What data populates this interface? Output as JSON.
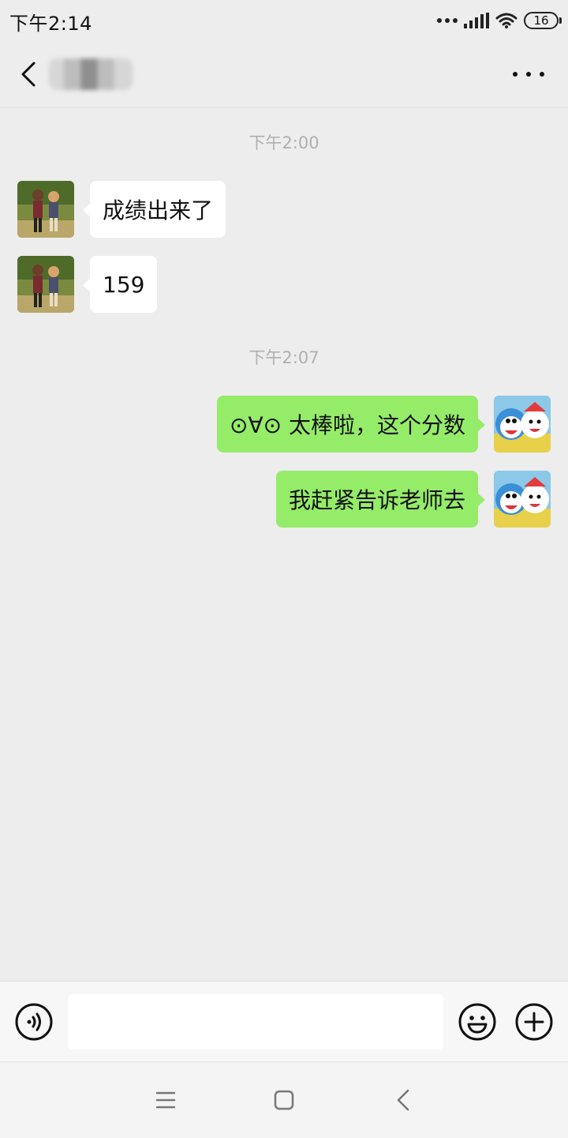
{
  "status_bar": {
    "time": "下午2:14",
    "battery": "16"
  },
  "header": {
    "contact_name": "",
    "back_icon": "chevron-left-icon",
    "more_icon": "more-dots-icon"
  },
  "chat": {
    "timestamps": [
      "下午2:00",
      "下午2:07"
    ],
    "messages": [
      {
        "side": "left",
        "text": "成绩出来了"
      },
      {
        "side": "left",
        "text": "159"
      },
      {
        "side": "right",
        "text": "⊙∀⊙ 太棒啦，这个分数"
      },
      {
        "side": "right",
        "text": "我赶紧告诉老师去"
      }
    ]
  },
  "input_bar": {
    "placeholder": "",
    "voice_icon": "voice-icon",
    "emoji_icon": "emoji-icon",
    "plus_icon": "plus-icon"
  },
  "system_nav": {
    "icons": [
      "menu-icon",
      "home-icon",
      "back-icon"
    ]
  },
  "colors": {
    "background": "#ededed",
    "sent_bubble": "#95ec69",
    "received_bubble": "#ffffff",
    "timestamp_text": "#b0b0b0"
  }
}
